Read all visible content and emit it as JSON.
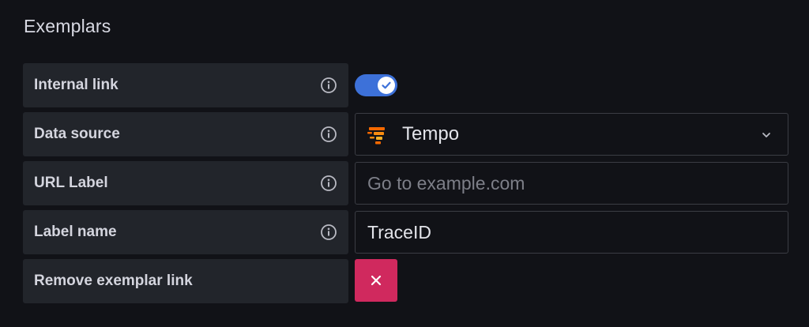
{
  "section": {
    "title": "Exemplars"
  },
  "rows": {
    "internal_link": {
      "label": "Internal link",
      "toggle_on": true
    },
    "data_source": {
      "label": "Data source",
      "value": "Tempo",
      "icon": "tempo-logo"
    },
    "url_label": {
      "label": "URL Label",
      "placeholder": "Go to example.com",
      "value": ""
    },
    "label_name": {
      "label": "Label name",
      "value": "TraceID"
    },
    "remove": {
      "label": "Remove exemplar link",
      "button_icon": "close-icon"
    }
  },
  "colors": {
    "toggle_on": "#3d71d9",
    "remove_button": "#d0295e",
    "label_background": "#22252b",
    "page_background": "#111217"
  }
}
